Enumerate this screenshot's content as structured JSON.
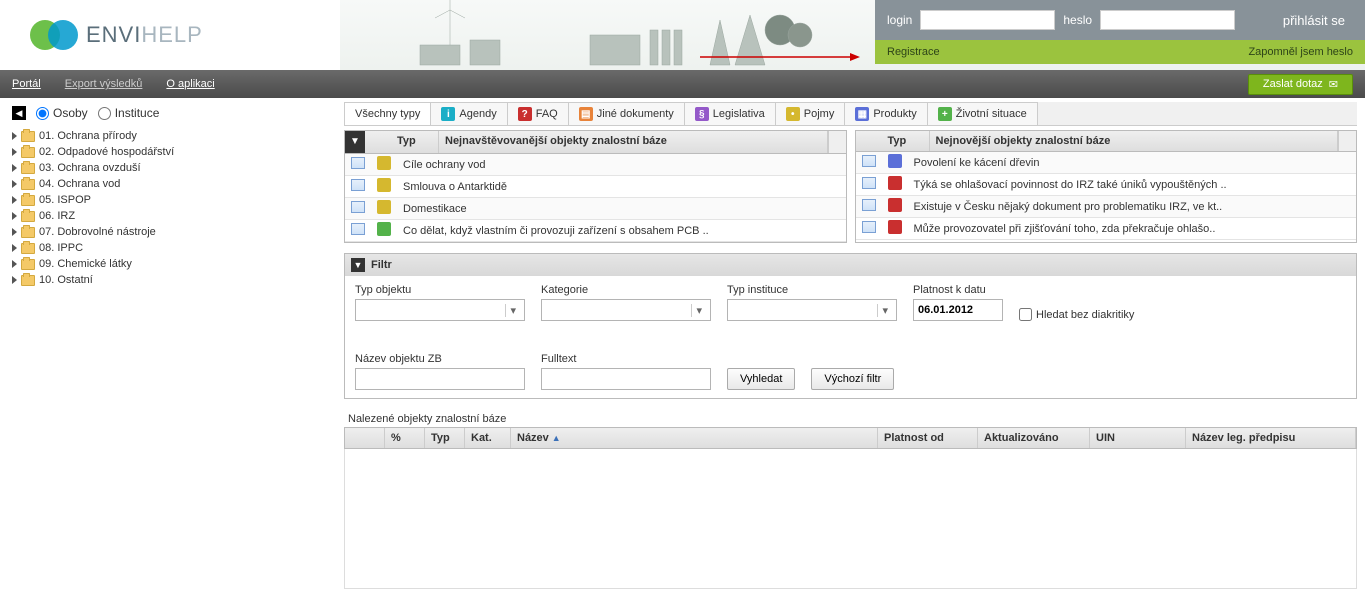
{
  "brand": {
    "part1": "ENVI",
    "part2": "HELP"
  },
  "login": {
    "login_label": "login",
    "heslo_label": "heslo",
    "submit": "přihlásit se"
  },
  "reg": {
    "register": "Registrace",
    "forgot": "Zapomněl jsem heslo"
  },
  "menu": {
    "portal": "Portál",
    "export": "Export výsledků",
    "about": "O aplikaci",
    "zaslat": "Zaslat dotaz"
  },
  "side": {
    "osoby": "Osoby",
    "instituce": "Instituce",
    "items": [
      "01. Ochrana přírody",
      "02. Odpadové hospodářství",
      "03. Ochrana ovzduší",
      "04. Ochrana vod",
      "05. ISPOP",
      "06. IRZ",
      "07. Dobrovolné nástroje",
      "08. IPPC",
      "09. Chemické látky",
      "10. Ostatní"
    ]
  },
  "tabs": [
    "Všechny typy",
    "Agendy",
    "FAQ",
    "Jiné dokumenty",
    "Legislativa",
    "Pojmy",
    "Produkty",
    "Životní situace"
  ],
  "panelA": {
    "typ": "Typ",
    "title": "Nejnavštěvovanější objekty znalostní báze",
    "rows": [
      {
        "c": "ylw",
        "t": "Cíle ochrany vod"
      },
      {
        "c": "ylw",
        "t": "Smlouva o Antarktidě"
      },
      {
        "c": "ylw",
        "t": "Domestikace"
      },
      {
        "c": "grn",
        "t": "Co dělat, když vlastním či provozuji zařízení s obsahem PCB .."
      }
    ]
  },
  "panelB": {
    "typ": "Typ",
    "title": "Nejnovější objekty znalostní báze",
    "rows": [
      {
        "c": "blu",
        "t": "Povolení ke kácení dřevin"
      },
      {
        "c": "red",
        "t": "Týká se ohlašovací povinnost do IRZ také úniků vypouštěných .."
      },
      {
        "c": "red",
        "t": "Existuje v Česku nějaký dokument pro problematiku IRZ, ve kt.."
      },
      {
        "c": "red",
        "t": "Může provozovatel při zjišťování toho, zda překračuje ohlašo.."
      }
    ]
  },
  "filter": {
    "title": "Filtr",
    "typ_obj": "Typ objektu",
    "kategorie": "Kategorie",
    "typ_inst": "Typ instituce",
    "platnost": "Platnost k datu",
    "date_val": "06.01.2012",
    "diak": "Hledat bez diakritiky",
    "nazev": "Název objektu ZB",
    "fulltext": "Fulltext",
    "vyhledat": "Vyhledat",
    "vychozi": "Výchozí filtr"
  },
  "results": {
    "title": "Nalezené objekty znalostní báze",
    "cols": {
      "pct": "%",
      "typ": "Typ",
      "kat": "Kat.",
      "nazev": "Název",
      "platod": "Platnost od",
      "aktual": "Aktualizováno",
      "uin": "UIN",
      "leg": "Název leg. předpisu"
    }
  }
}
